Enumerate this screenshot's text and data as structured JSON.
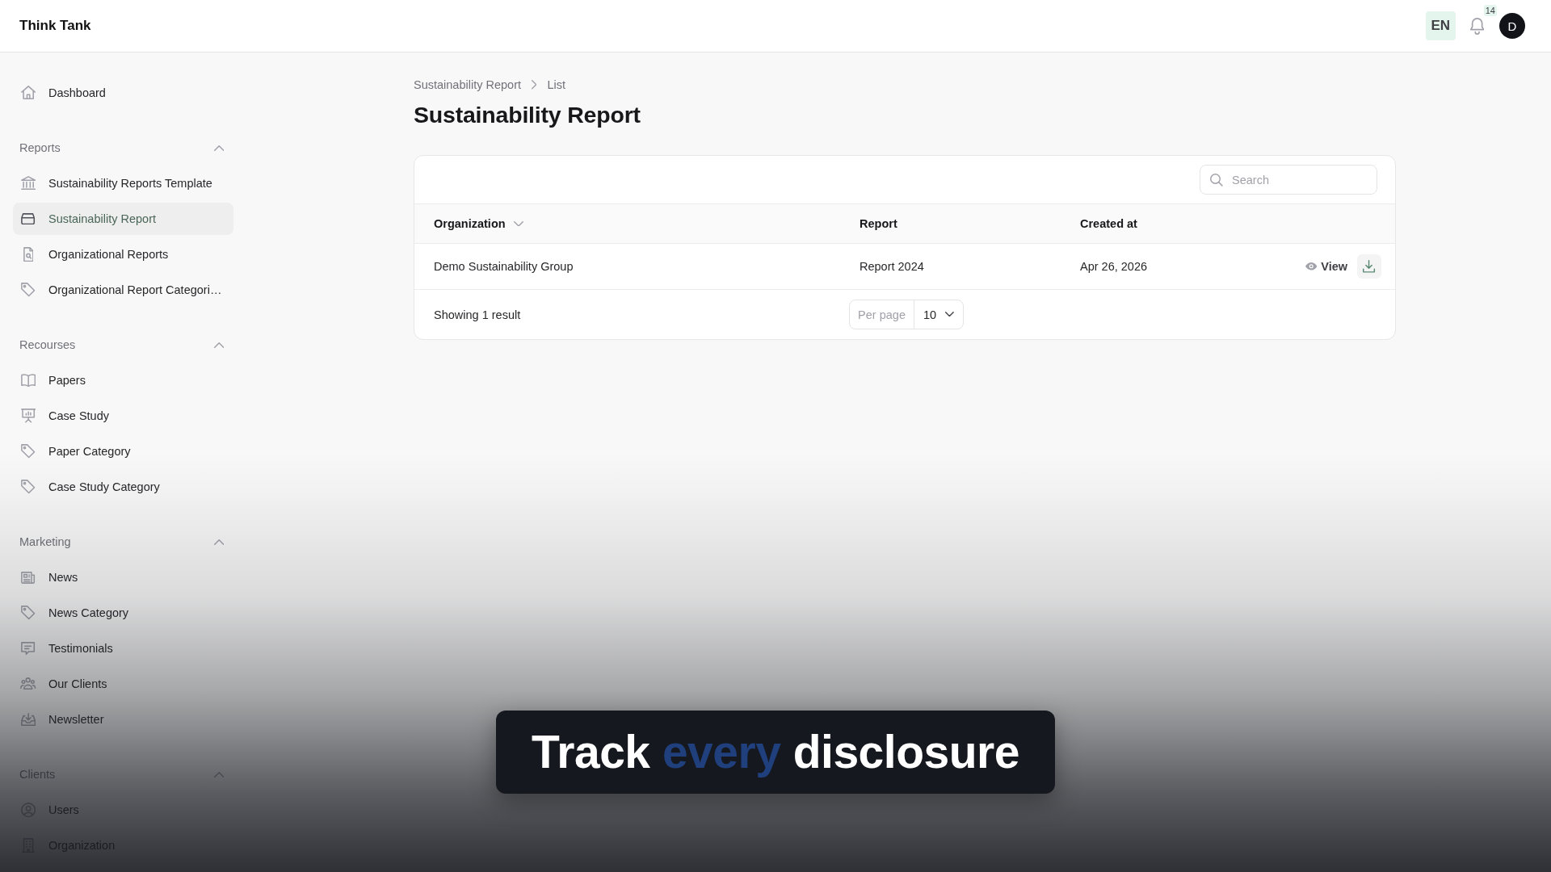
{
  "app": {
    "title": "Think Tank"
  },
  "header": {
    "language": "EN",
    "notifications": "14",
    "avatar": "D"
  },
  "sidebar": {
    "groups": [
      {
        "items": [
          {
            "label": "Dashboard",
            "selected": false
          }
        ]
      },
      {
        "title": "Reports",
        "expanded": true,
        "items": [
          {
            "label": "Sustainability Reports Template",
            "selected": false
          },
          {
            "label": "Sustainability Report",
            "selected": true
          },
          {
            "label": "Organizational Reports",
            "selected": false
          },
          {
            "label": "Organizational Report Categori…",
            "selected": false
          }
        ]
      },
      {
        "title": "Recourses",
        "expanded": true,
        "items": [
          {
            "label": "Papers",
            "selected": false
          },
          {
            "label": "Case Study",
            "selected": false
          },
          {
            "label": "Paper Category",
            "selected": false
          },
          {
            "label": "Case Study Category",
            "selected": false
          }
        ]
      },
      {
        "title": "Marketing",
        "expanded": true,
        "items": [
          {
            "label": "News",
            "selected": false
          },
          {
            "label": "News Category",
            "selected": false
          },
          {
            "label": "Testimonials",
            "selected": false
          },
          {
            "label": "Our Clients",
            "selected": false
          },
          {
            "label": "Newsletter",
            "selected": false
          }
        ]
      },
      {
        "title": "Clients",
        "expanded": true,
        "items": [
          {
            "label": "Users",
            "selected": false
          },
          {
            "label": "Organization",
            "selected": false
          }
        ]
      }
    ]
  },
  "breadcrumb": [
    "Sustainability Report",
    "List"
  ],
  "page_title": "Sustainability Report",
  "table": {
    "search": {
      "placeholder": "Search"
    },
    "columns": [
      {
        "label": "Organization",
        "sortable": true
      },
      {
        "label": "Report",
        "sortable": false
      },
      {
        "label": "Created at",
        "sortable": false
      }
    ],
    "rows": [
      {
        "cells": [
          "Demo Sustainability Group",
          "Report 2024",
          "Apr 26, 2026"
        ],
        "view": "View"
      }
    ],
    "footer": {
      "summary": "Showing 1 result",
      "per_page_label": "Per page",
      "per_page_value": "10"
    }
  },
  "caption": {
    "parts": [
      {
        "text": "Track",
        "highlight": false
      },
      {
        "text": "every",
        "highlight": true
      },
      {
        "text": "disclosure",
        "highlight": false
      }
    ]
  }
}
